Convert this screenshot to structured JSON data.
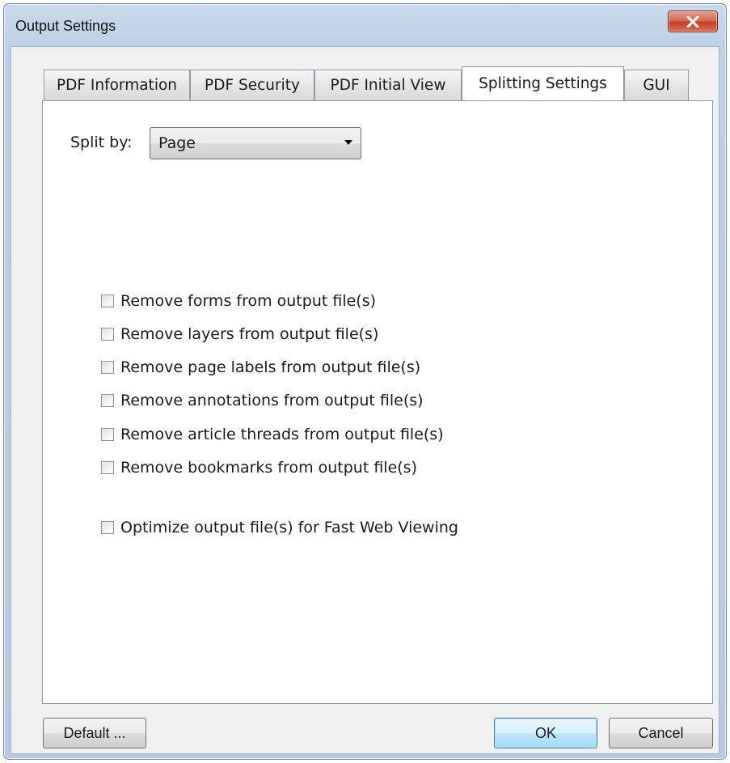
{
  "window": {
    "title": "Output Settings",
    "close_icon": "close-icon"
  },
  "tabs": [
    {
      "label": "PDF Information",
      "active": false
    },
    {
      "label": "PDF Security",
      "active": false
    },
    {
      "label": "PDF Initial View",
      "active": false
    },
    {
      "label": "Splitting Settings",
      "active": true
    },
    {
      "label": "GUI",
      "active": false
    }
  ],
  "split": {
    "label": "Split by:",
    "selected": "Page"
  },
  "options": [
    {
      "label": "Remove forms from output file(s)",
      "checked": false
    },
    {
      "label": "Remove layers from output file(s)",
      "checked": false
    },
    {
      "label": "Remove page labels from output file(s)",
      "checked": false
    },
    {
      "label": "Remove annotations from output file(s)",
      "checked": false
    },
    {
      "label": "Remove article threads from output file(s)",
      "checked": false
    },
    {
      "label": "Remove bookmarks from output file(s)",
      "checked": false
    }
  ],
  "optimize": {
    "label": "Optimize output file(s) for Fast Web Viewing",
    "checked": false
  },
  "buttons": {
    "default": "Default ...",
    "ok": "OK",
    "cancel": "Cancel"
  },
  "colors": {
    "titlebar": "#bcd0e4",
    "close_button": "#c4402a",
    "focused_button": "#bee6fd"
  }
}
